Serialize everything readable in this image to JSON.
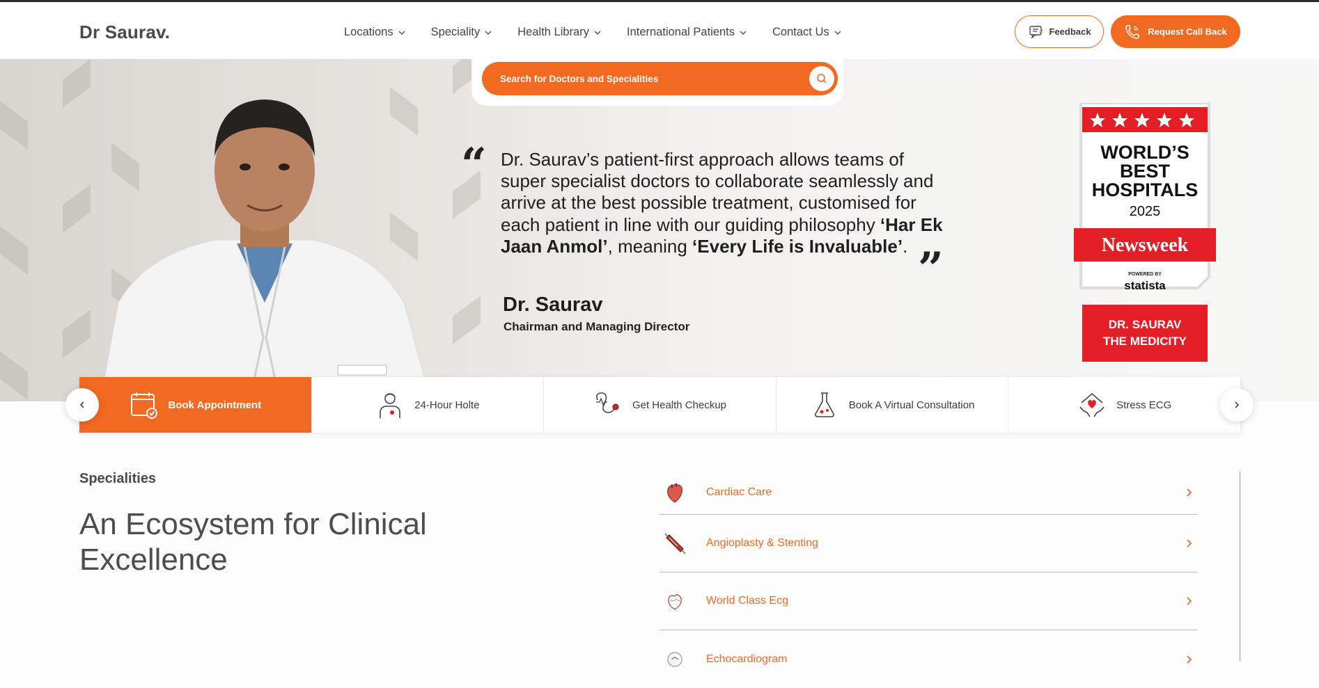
{
  "brand": {
    "logo": "Dr Saurav.",
    "accent": "#f26a21"
  },
  "nav": [
    {
      "label": "Locations",
      "icon": "chevron-down-icon"
    },
    {
      "label": "Speciality",
      "icon": "chevron-down-icon"
    },
    {
      "label": "Health Library",
      "icon": "chevron-down-icon"
    },
    {
      "label": "International Patients",
      "icon": "chevron-down-icon"
    },
    {
      "label": "Contact Us",
      "icon": "chevron-down-icon"
    }
  ],
  "header_actions": {
    "feedback": "Feedback",
    "callback": "Request Call Back"
  },
  "search": {
    "placeholder": "Search for Doctors and Specialities"
  },
  "hero": {
    "quote_part1": "Dr. Saurav’s patient-first approach allows teams of super specialist doctors to collaborate seamlessly and arrive at the best possible treatment, customised for each patient in line with our guiding philosophy ",
    "quote_bold1": "‘Har Ek Jaan Anmol’",
    "quote_part2": ", meaning ",
    "quote_bold2": "‘Every Life is Invaluable’",
    "quote_part3": ".",
    "name": "Dr. Saurav",
    "role": "Chairman and Managing Director",
    "badge": {
      "line1": "WORLD’S",
      "line2": "BEST",
      "line3": "HOSPITALS",
      "year": "2025",
      "publisher": "Newsweek",
      "powered_by": "POWERED BY",
      "partner": "statista",
      "hospital1": "DR. SAURAV",
      "hospital2": "THE MEDICITY",
      "stars": 5
    }
  },
  "quick_links": [
    {
      "label": "Book Appointment",
      "icon": "calendar-check-icon",
      "active": true
    },
    {
      "label": "24-Hour Holte",
      "icon": "doctor-icon",
      "active": false
    },
    {
      "label": "Get Health Checkup",
      "icon": "stethoscope-icon",
      "active": false
    },
    {
      "label": "Book A Virtual Consultation",
      "icon": "flask-icon",
      "active": false
    },
    {
      "label": "Stress ECG",
      "icon": "heart-hands-icon",
      "active": false
    }
  ],
  "specialities": {
    "label": "Specialities",
    "title": "An Ecosystem for Clinical Excellence",
    "items": [
      {
        "name": "Cardiac Care",
        "icon": "heart-organ-icon"
      },
      {
        "name": "Angioplasty & Stenting",
        "icon": "stent-icon"
      },
      {
        "name": "World Class Ecg",
        "icon": "heart-sketch-icon"
      },
      {
        "name": "Echocardiogram",
        "icon": "echo-icon"
      }
    ]
  }
}
